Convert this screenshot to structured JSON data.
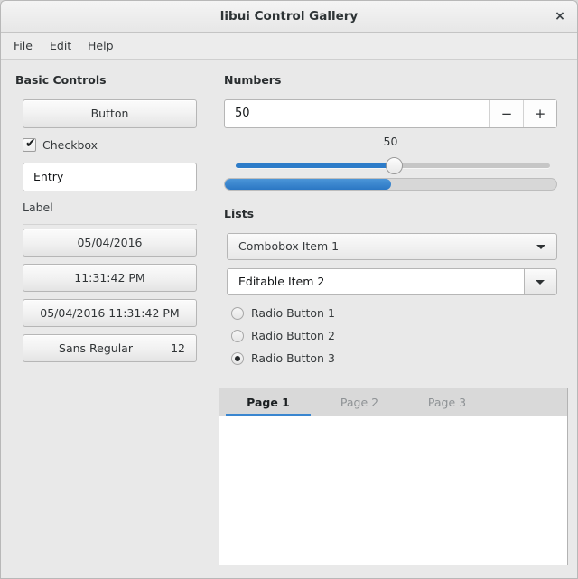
{
  "window": {
    "title": "libui Control Gallery",
    "close_label": "×"
  },
  "menubar": {
    "items": [
      {
        "label": "File"
      },
      {
        "label": "Edit"
      },
      {
        "label": "Help"
      }
    ]
  },
  "basic_controls": {
    "group_title": "Basic Controls",
    "button_label": "Button",
    "checkbox": {
      "label": "Checkbox",
      "checked": true,
      "mark": "✔"
    },
    "entry": {
      "value": "Entry",
      "placeholder": ""
    },
    "label": "Label",
    "date_button": "05/04/2016",
    "time_button": "11:31:42 PM",
    "datetime_button": "05/04/2016 11:31:42 PM",
    "font_button": {
      "family": "Sans Regular",
      "size": "12"
    }
  },
  "numbers": {
    "group_title": "Numbers",
    "spinbox": {
      "value": "50",
      "decrement_label": "−",
      "increment_label": "+"
    },
    "slider": {
      "value": "50",
      "min": 0,
      "max": 100
    },
    "progress": {
      "value": 50
    }
  },
  "lists": {
    "group_title": "Lists",
    "combobox": {
      "value": "Combobox Item 1"
    },
    "editable_combobox": {
      "value": "Editable Item 2"
    },
    "radios": [
      {
        "label": "Radio Button 1",
        "selected": false
      },
      {
        "label": "Radio Button 2",
        "selected": false
      },
      {
        "label": "Radio Button 3",
        "selected": true
      }
    ]
  },
  "tabs": {
    "items": [
      {
        "label": "Page 1",
        "active": true
      },
      {
        "label": "Page 2",
        "active": false
      },
      {
        "label": "Page 3",
        "active": false
      }
    ]
  },
  "colors": {
    "accent": "#2d7cc9",
    "tab_underline": "#3a86d0",
    "window_bg": "#e9e9e9"
  }
}
